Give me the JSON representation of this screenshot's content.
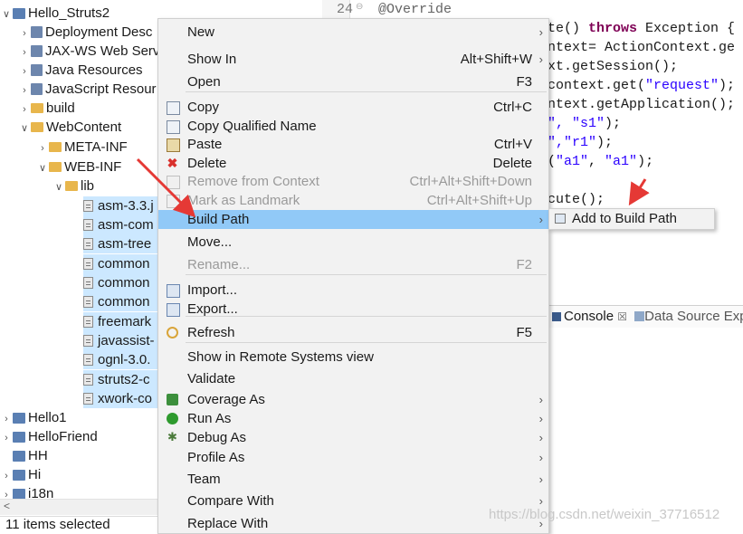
{
  "tree": {
    "items": [
      {
        "label": "Hello_Struts2",
        "arrow": "∨",
        "selected": false
      },
      {
        "label": "Deployment Desc",
        "arrow": "›",
        "selected": false
      },
      {
        "label": "JAX-WS Web Serv",
        "arrow": "›",
        "selected": false
      },
      {
        "label": "Java Resources",
        "arrow": "›",
        "selected": false
      },
      {
        "label": "JavaScript Resour",
        "arrow": "›",
        "selected": false
      },
      {
        "label": "build",
        "arrow": "›",
        "selected": false
      },
      {
        "label": "WebContent",
        "arrow": "∨",
        "selected": false
      },
      {
        "label": "META-INF",
        "arrow": "›",
        "selected": false
      },
      {
        "label": "WEB-INF",
        "arrow": "∨",
        "selected": false
      },
      {
        "label": "lib",
        "arrow": "∨",
        "selected": false
      },
      {
        "label": "asm-3.3.j",
        "selected": true
      },
      {
        "label": "asm-com",
        "selected": true
      },
      {
        "label": "asm-tree",
        "selected": true
      },
      {
        "label": "common",
        "selected": true
      },
      {
        "label": "common",
        "selected": true
      },
      {
        "label": "common",
        "selected": true
      },
      {
        "label": "freemark",
        "selected": true
      },
      {
        "label": "javassist-",
        "selected": true
      },
      {
        "label": "ognl-3.0.",
        "selected": true
      },
      {
        "label": "struts2-c",
        "selected": true
      },
      {
        "label": "xwork-co",
        "selected": true
      },
      {
        "label": "Hello1",
        "arrow": "›",
        "selected": false
      },
      {
        "label": "HelloFriend",
        "arrow": "›",
        "selected": false
      },
      {
        "label": "HH",
        "arrow": "",
        "selected": false
      },
      {
        "label": "Hi",
        "arrow": "›",
        "selected": false
      },
      {
        "label": "i18n",
        "arrow": "›",
        "selected": false
      }
    ]
  },
  "status": {
    "text": "11 items selected"
  },
  "editor": {
    "line_number": "24",
    "lines": [
      {
        "parts": [
          {
            "t": "@Override",
            "c": "ann"
          }
        ]
      },
      {
        "parts": [
          {
            "t": "te() ",
            "c": ""
          },
          {
            "t": "throws",
            "c": "kw"
          },
          {
            "t": " Exception {",
            "c": ""
          }
        ]
      },
      {
        "parts": [
          {
            "t": "ntext= ActionContext.ge",
            "c": ""
          }
        ]
      },
      {
        "parts": [
          {
            "t": "xt.getSession();",
            "c": ""
          }
        ]
      },
      {
        "parts": [
          {
            "t": "context.get(",
            "c": ""
          },
          {
            "t": "\"request\"",
            "c": "str"
          },
          {
            "t": ");",
            "c": ""
          }
        ]
      },
      {
        "parts": [
          {
            "t": "ntext.getApplication();",
            "c": ""
          }
        ]
      },
      {
        "parts": [
          {
            "t": "\", ",
            "c": "str"
          },
          {
            "t": "\"s1\"",
            "c": "str"
          },
          {
            "t": ");",
            "c": ""
          }
        ]
      },
      {
        "parts": [
          {
            "t": "\",",
            "c": "str"
          },
          {
            "t": "\"r1\"",
            "c": "str"
          },
          {
            "t": ");",
            "c": ""
          }
        ]
      },
      {
        "parts": [
          {
            "t": "(",
            "c": ""
          },
          {
            "t": "\"a1\"",
            "c": "str"
          },
          {
            "t": ", ",
            "c": ""
          },
          {
            "t": "\"a1\"",
            "c": "str"
          },
          {
            "t": ");",
            "c": ""
          }
        ]
      },
      {
        "parts": [
          {
            "t": "",
            "c": ""
          }
        ]
      },
      {
        "parts": [
          {
            "t": "cute();",
            "c": ""
          }
        ]
      }
    ]
  },
  "console": {
    "tab_console": "Console",
    "tab_close": "☒",
    "tab_datasource": "Data Source Exp"
  },
  "menu": {
    "items": [
      {
        "label": "New",
        "key": "",
        "sub": true,
        "disabled": false,
        "icon": ""
      },
      {
        "label": "Show In",
        "key": "Alt+Shift+W",
        "sub": true,
        "disabled": false,
        "icon": ""
      },
      {
        "label": "Open",
        "key": "F3",
        "sub": false,
        "disabled": false,
        "icon": ""
      },
      {
        "label": "Copy",
        "key": "Ctrl+C",
        "sub": false,
        "disabled": false,
        "icon": "copy-icon"
      },
      {
        "label": "Copy Qualified Name",
        "key": "",
        "sub": false,
        "disabled": false,
        "icon": "copy-qualified-icon"
      },
      {
        "label": "Paste",
        "key": "Ctrl+V",
        "sub": false,
        "disabled": false,
        "icon": "paste-icon"
      },
      {
        "label": "Delete",
        "key": "Delete",
        "sub": false,
        "disabled": false,
        "icon": "delete-icon"
      },
      {
        "label": "Remove from Context",
        "key": "Ctrl+Alt+Shift+Down",
        "sub": false,
        "disabled": true,
        "icon": "remove-context-icon"
      },
      {
        "label": "Mark as Landmark",
        "key": "Ctrl+Alt+Shift+Up",
        "sub": false,
        "disabled": true,
        "icon": "landmark-icon"
      },
      {
        "label": "Build Path",
        "key": "",
        "sub": true,
        "disabled": false,
        "icon": "",
        "highlighted": true
      },
      {
        "label": "Move...",
        "key": "",
        "sub": false,
        "disabled": false,
        "icon": ""
      },
      {
        "label": "Rename...",
        "key": "F2",
        "sub": false,
        "disabled": true,
        "icon": ""
      },
      {
        "label": "Import...",
        "key": "",
        "sub": false,
        "disabled": false,
        "icon": "import-icon"
      },
      {
        "label": "Export...",
        "key": "",
        "sub": false,
        "disabled": false,
        "icon": "export-icon"
      },
      {
        "label": "Refresh",
        "key": "F5",
        "sub": false,
        "disabled": false,
        "icon": "refresh-icon"
      },
      {
        "label": "Show in Remote Systems view",
        "key": "",
        "sub": false,
        "disabled": false,
        "icon": ""
      },
      {
        "label": "Validate",
        "key": "",
        "sub": false,
        "disabled": false,
        "icon": ""
      },
      {
        "label": "Coverage As",
        "key": "",
        "sub": true,
        "disabled": false,
        "icon": "coverage-icon"
      },
      {
        "label": "Run As",
        "key": "",
        "sub": true,
        "disabled": false,
        "icon": "run-icon"
      },
      {
        "label": "Debug As",
        "key": "",
        "sub": true,
        "disabled": false,
        "icon": "debug-icon"
      },
      {
        "label": "Profile As",
        "key": "",
        "sub": true,
        "disabled": false,
        "icon": ""
      },
      {
        "label": "Team",
        "key": "",
        "sub": true,
        "disabled": false,
        "icon": ""
      },
      {
        "label": "Compare With",
        "key": "",
        "sub": true,
        "disabled": false,
        "icon": ""
      },
      {
        "label": "Replace With",
        "key": "",
        "sub": true,
        "disabled": false,
        "icon": ""
      }
    ]
  },
  "submenu": {
    "label": "Add to Build Path",
    "icon": "add-build-path-icon"
  },
  "watermark": "https://blog.csdn.net/weixin_37716512",
  "colors": {
    "selection": "#cce8ff",
    "menu_highlight": "#91c9f7",
    "annotation_arrow": "#e53935"
  }
}
